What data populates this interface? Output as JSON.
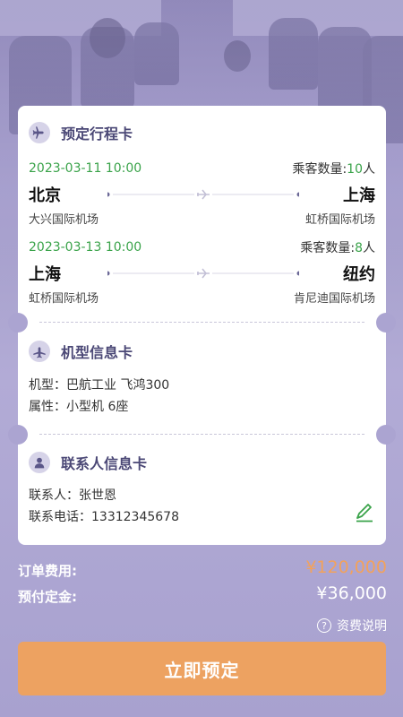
{
  "itinerary": {
    "title": "预定行程卡",
    "flights": [
      {
        "datetime": "2023-03-11 10:00",
        "pax_label": "乘客数量:",
        "pax_count": "10",
        "pax_unit": "人",
        "from_city": "北京",
        "to_city": "上海",
        "from_airport": "大兴国际机场",
        "to_airport": "虹桥国际机场"
      },
      {
        "datetime": "2023-03-13 10:00",
        "pax_label": "乘客数量:",
        "pax_count": "8",
        "pax_unit": "人",
        "from_city": "上海",
        "to_city": "纽约",
        "from_airport": "虹桥国际机场",
        "to_airport": "肯尼迪国际机场"
      }
    ]
  },
  "aircraft": {
    "title": "机型信息卡",
    "model": "机型：巴航工业  飞鸿300",
    "attrs": "属性：小型机 6座"
  },
  "contact": {
    "title": "联系人信息卡",
    "name": "联系人：张世恩",
    "phone": "联系电话：13312345678"
  },
  "summary": {
    "order_fee_label": "订单费用:",
    "order_fee_value": "¥120,000",
    "deposit_label": "预付定金:",
    "deposit_value": "¥36,000",
    "fee_help": "资费说明"
  },
  "book_button": "立即预定",
  "colors": {
    "accent_green": "#3aa34a",
    "order_fee": "#f2a25c",
    "button": "#eda261",
    "title_purple": "#4b4876"
  }
}
